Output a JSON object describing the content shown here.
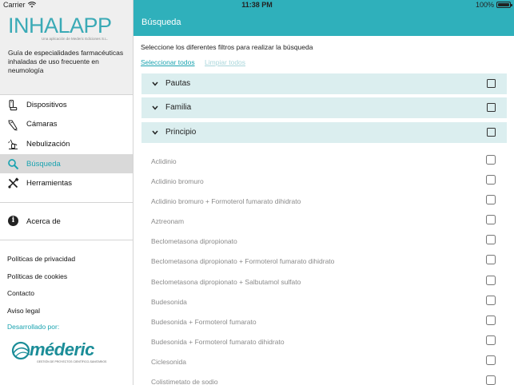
{
  "statusbar": {
    "carrier": "Carrier",
    "time": "11:38 PM",
    "battery": "100%",
    "battery_level": 1.0
  },
  "brand": {
    "logo": "INHALAPP",
    "logo_sub": "Una aplicación de Mederic Ediciones S.L.",
    "tagline": "Guía de especialidades farmacéuticas inhaladas de uso frecuente en neumología"
  },
  "nav": {
    "items": [
      {
        "label": "Dispositivos",
        "icon": "inhaler-icon"
      },
      {
        "label": "Cámaras",
        "icon": "spacer-chamber-icon"
      },
      {
        "label": "Nebulización",
        "icon": "nebulizer-icon"
      },
      {
        "label": "Búsqueda",
        "icon": "search-icon"
      },
      {
        "label": "Herramientas",
        "icon": "tools-icon"
      }
    ],
    "active": "Búsqueda",
    "about": "Acerca de",
    "about_icon": "info-icon"
  },
  "links": {
    "privacy": "Políticas de privacidad",
    "cookies": "Políticas de cookies",
    "contact": "Contacto",
    "legal": "Aviso legal"
  },
  "developer": {
    "label": "Desarrollado por:",
    "logo": "méderic",
    "logo_sub": "GESTIÓN DE PROYECTOS CIENTÍFICO-SANITARIOS"
  },
  "main": {
    "title": "Búsqueda",
    "instructions": "Seleccione los diferentes filtros para realizar la búsqueda",
    "select_all": "Seleccionar todos",
    "clear_all": "Limpiar todos",
    "sections": [
      {
        "label": "Pautas",
        "expanded": false
      },
      {
        "label": "Familia",
        "expanded": false
      },
      {
        "label": "Principio",
        "expanded": true
      }
    ],
    "items": [
      "Aclidinio",
      "Aclidinio bromuro",
      "Aclidinio bromuro + Formoterol fumarato dihidrato",
      "Aztreonam",
      "Beclometasona dipropionato",
      "Beclometasona dipropionato + Formoterol fumarato dihidrato",
      "Beclometasona dipropionato + Salbutamol sulfato",
      "Budesonida",
      "Budesonida + Formoterol fumarato",
      "Budesonida + Formoterol fumarato dihidrato",
      "Ciclesonida",
      "Colistimetato de sodio"
    ]
  },
  "colors": {
    "accent": "#2fb0bb",
    "link": "#1aa3b0",
    "section_bg": "#dbeeef",
    "sidebar_bg": "#efefef"
  }
}
